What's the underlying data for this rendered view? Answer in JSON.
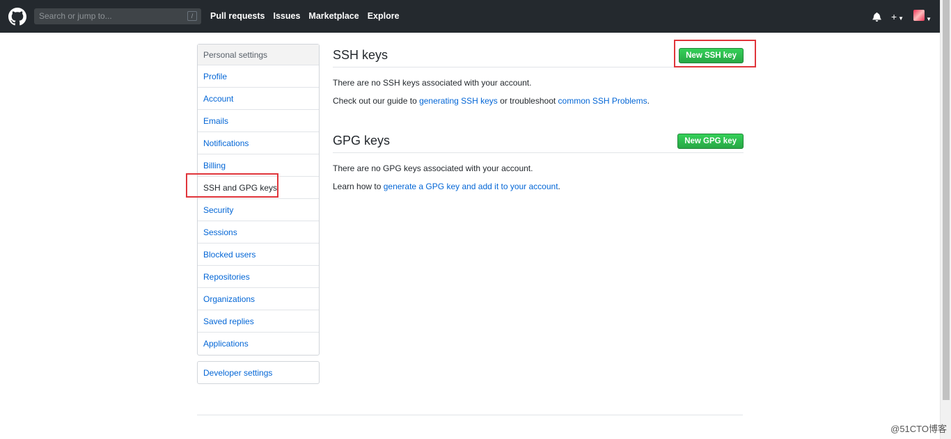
{
  "header": {
    "search_placeholder": "Search or jump to...",
    "search_key": "/",
    "nav": [
      "Pull requests",
      "Issues",
      "Marketplace",
      "Explore"
    ]
  },
  "sidebar": {
    "title": "Personal settings",
    "items": [
      "Profile",
      "Account",
      "Emails",
      "Notifications",
      "Billing",
      "SSH and GPG keys",
      "Security",
      "Sessions",
      "Blocked users",
      "Repositories",
      "Organizations",
      "Saved replies",
      "Applications"
    ],
    "active_index": 5,
    "developer_settings": "Developer settings"
  },
  "ssh": {
    "title": "SSH keys",
    "button": "New SSH key",
    "empty": "There are no SSH keys associated with your account.",
    "guide_prefix": "Check out our guide to ",
    "guide_link1": "generating SSH keys",
    "guide_mid": " or troubleshoot ",
    "guide_link2": "common SSH Problems",
    "guide_suffix": "."
  },
  "gpg": {
    "title": "GPG keys",
    "button": "New GPG key",
    "empty": "There are no GPG keys associated with your account.",
    "learn_prefix": "Learn how to ",
    "learn_link": "generate a GPG key and add it to your account",
    "learn_suffix": "."
  },
  "watermark": "@51CTO博客",
  "colors": {
    "header_bg": "#24292e",
    "link": "#0366d6",
    "button_green": "#28a745",
    "highlight": "#e0353b"
  }
}
